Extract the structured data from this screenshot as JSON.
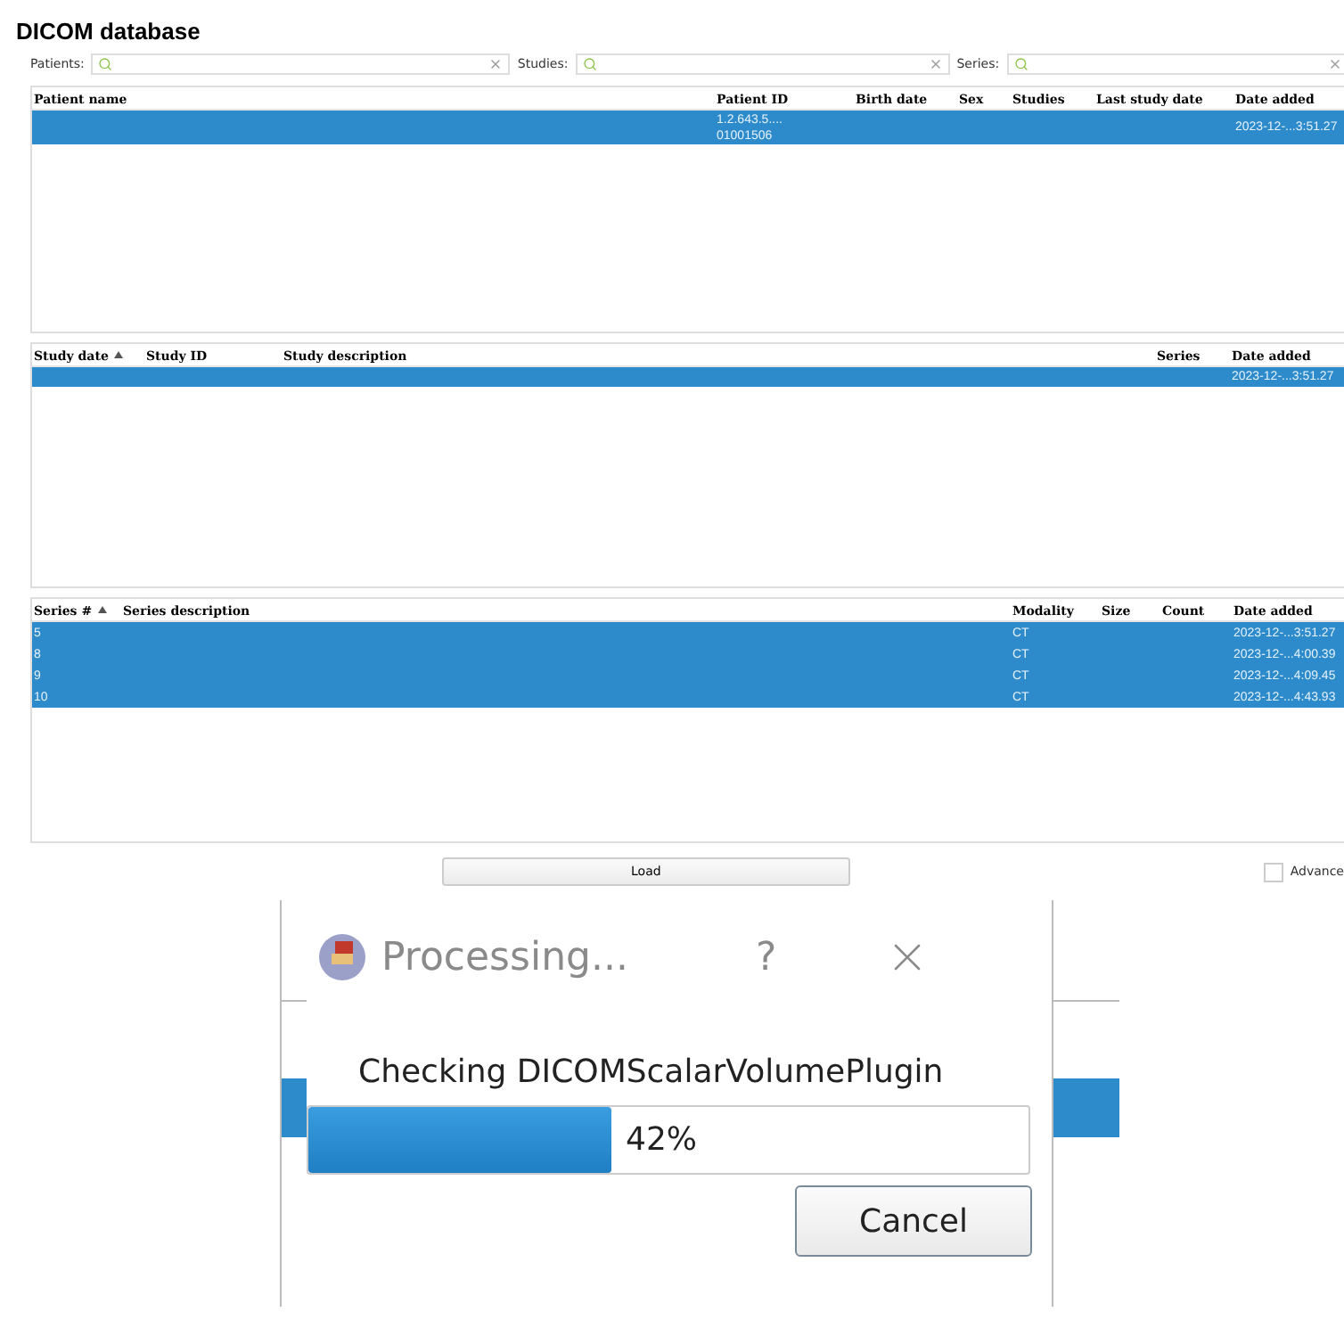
{
  "title": "DICOM database",
  "filters": [
    {
      "label": "Patients:"
    },
    {
      "label": "Studies:"
    },
    {
      "label": "Series:"
    }
  ],
  "tables": [
    {
      "columns": [
        {
          "label": "Patient name",
          "sorted": false
        },
        {
          "label": "Patient ID",
          "sorted": false
        },
        {
          "label": "Birth date",
          "sorted": false
        },
        {
          "label": "Sex",
          "sorted": false
        },
        {
          "label": "Studies",
          "sorted": false
        },
        {
          "label": "Last study date",
          "sorted": false
        },
        {
          "label": "Date added",
          "sorted": false
        }
      ],
      "rows": [
        {
          "selected": true,
          "cells": [
            {},
            {
              "text": "1.2.643.5....\n01001506"
            },
            {},
            {},
            {},
            {},
            {
              "text": "2023-12-...3:51.27"
            }
          ]
        }
      ]
    },
    {
      "columns": [
        {
          "label": "Study date",
          "sorted": true
        },
        {
          "label": "Study ID",
          "sorted": false
        },
        {
          "label": "Study description",
          "sorted": false
        },
        {
          "label": "Series",
          "sorted": false
        },
        {
          "label": "Date added",
          "sorted": false
        }
      ],
      "rows": [
        {
          "selected": true,
          "cells": [
            {},
            {},
            {},
            {},
            {
              "text": "2023-12-...3:51.27"
            }
          ]
        }
      ]
    },
    {
      "columns": [
        {
          "label": "Series #",
          "sorted": true
        },
        {
          "label": "Series description",
          "sorted": false
        },
        {
          "label": "Modality",
          "sorted": false
        },
        {
          "label": "Size",
          "sorted": false
        },
        {
          "label": "Count",
          "sorted": false
        },
        {
          "label": "Date added",
          "sorted": false
        }
      ],
      "rows": [
        {
          "selected": true,
          "cells": [
            {
              "text": "5"
            },
            {},
            {
              "text": "CT"
            },
            {},
            {},
            {
              "text": "2023-12-...3:51.27"
            }
          ]
        },
        {
          "selected": true,
          "cells": [
            {
              "text": "8"
            },
            {},
            {
              "text": "CT"
            },
            {},
            {},
            {
              "text": "2023-12-...4:00.39"
            }
          ]
        },
        {
          "selected": true,
          "cells": [
            {
              "text": "9"
            },
            {},
            {
              "text": "CT"
            },
            {},
            {},
            {
              "text": "2023-12-...4:09.45"
            }
          ]
        },
        {
          "selected": true,
          "cells": [
            {
              "text": "10"
            },
            {},
            {
              "text": "CT"
            },
            {},
            {},
            {
              "text": "2023-12-...4:43.93"
            }
          ]
        }
      ]
    }
  ],
  "load_button": "Load",
  "advanced": {
    "label": "Advance",
    "checked": false
  },
  "dialog": {
    "title": "Processing...",
    "help": "?",
    "message": "Checking DICOMScalarVolumePlugin",
    "progress": {
      "level": 0.42,
      "reading": "42%"
    },
    "button": "Cancel"
  }
}
